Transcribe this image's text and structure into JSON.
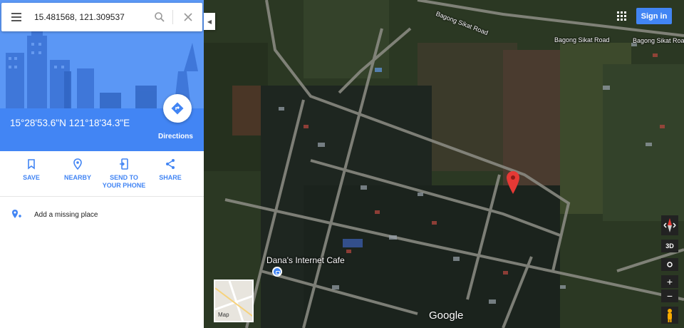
{
  "search": {
    "value": "15.481568, 121.309537"
  },
  "place": {
    "coordinates_dms": "15°28'53.6\"N 121°18'34.3\"E",
    "directions_label": "Directions"
  },
  "actions": [
    {
      "label": "SAVE",
      "icon": "bookmark-icon"
    },
    {
      "label": "NEARBY",
      "icon": "nearby-pin-icon"
    },
    {
      "label": "SEND TO YOUR PHONE",
      "icon": "send-to-phone-icon"
    },
    {
      "label": "SHARE",
      "icon": "share-icon"
    }
  ],
  "add_place_label": "Add a missing place",
  "map": {
    "road_labels": [
      "Bagong Sikat Road",
      "Bagong Sikat Road",
      "Bagong Sikat Road"
    ],
    "poi": {
      "name": "Dana's Internet Cafe",
      "icon": "shopping-bag-icon"
    },
    "signin_label": "Sign in",
    "google_logo": "Google",
    "map_toggle_label": "Map",
    "btn_3d": "3D",
    "zoom_in": "+",
    "zoom_out": "−"
  },
  "colors": {
    "accent": "#4285f4",
    "marker": "#e53935"
  }
}
